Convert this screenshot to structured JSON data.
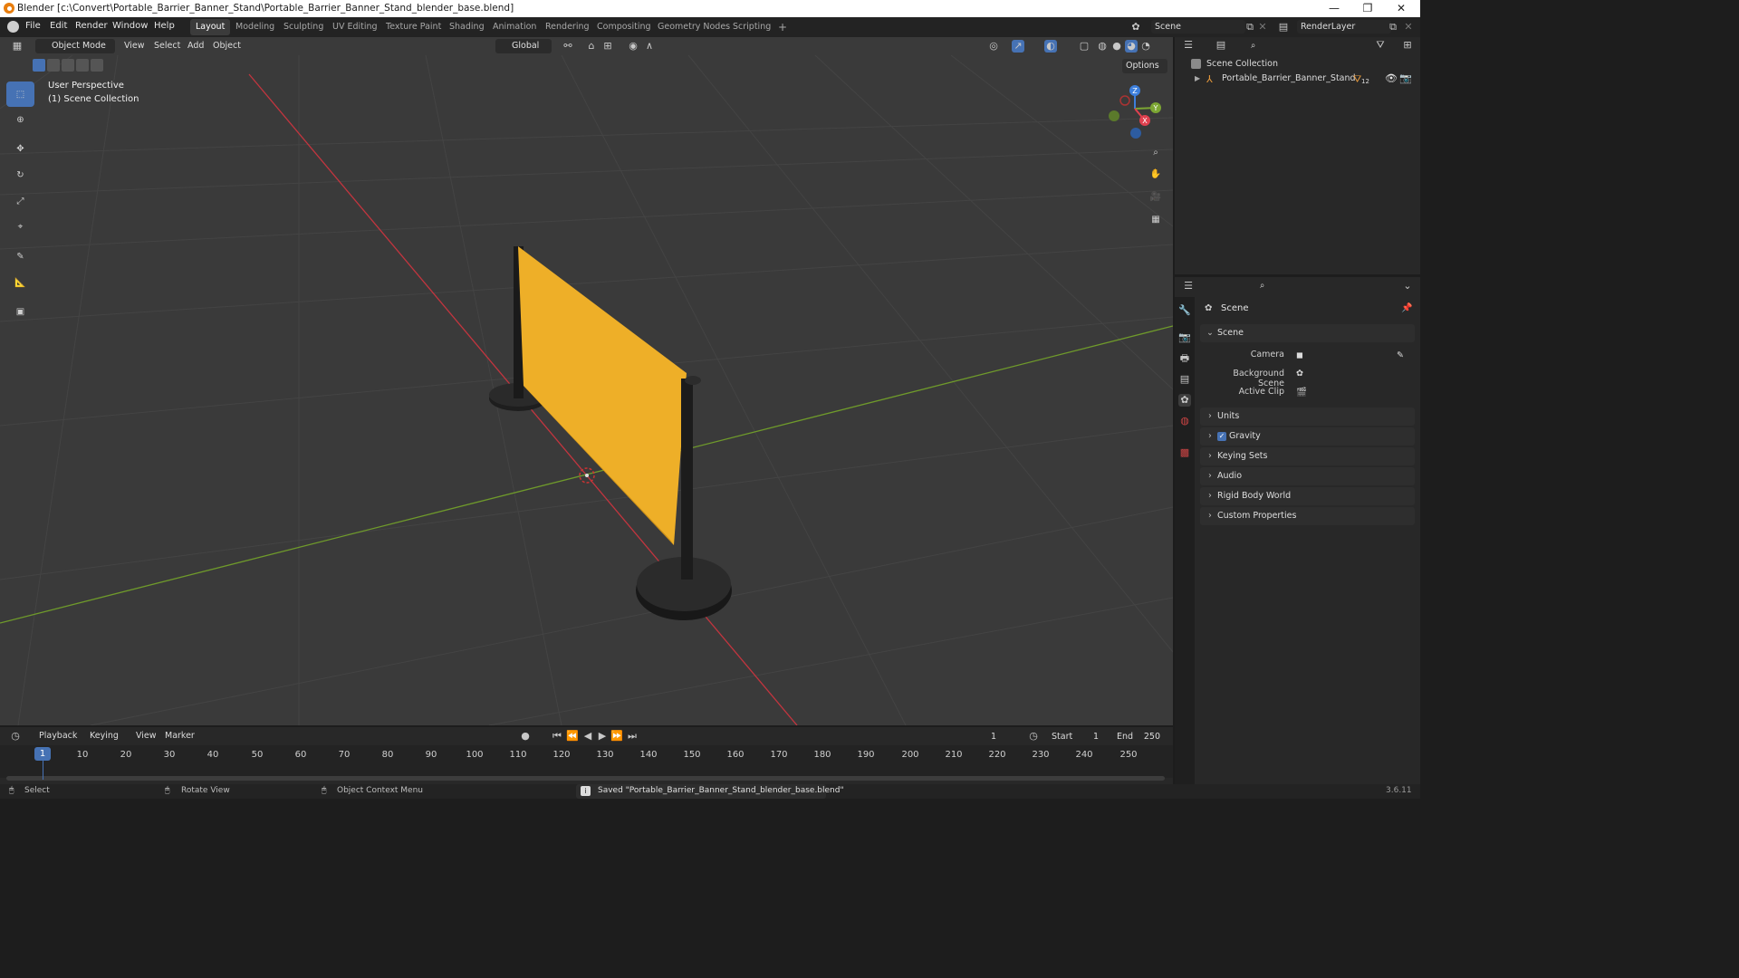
{
  "window": {
    "title": "Blender [c:\\Convert\\Portable_Barrier_Banner_Stand\\Portable_Barrier_Banner_Stand_blender_base.blend]",
    "controls": [
      "—",
      "❐",
      "✕"
    ]
  },
  "menu": {
    "items": [
      "File",
      "Edit",
      "Render",
      "Window",
      "Help"
    ],
    "workspaces": [
      "Layout",
      "Modeling",
      "Sculpting",
      "UV Editing",
      "Texture Paint",
      "Shading",
      "Animation",
      "Rendering",
      "Compositing",
      "Geometry Nodes",
      "Scripting"
    ],
    "add_tab": "+",
    "scene": "Scene",
    "view_layer": "RenderLayer"
  },
  "viewport": {
    "mode": "Object Mode",
    "menus": [
      "View",
      "Select",
      "Add",
      "Object"
    ],
    "orientation": "Global",
    "options_label": "Options",
    "overlay_line1": "User Perspective",
    "overlay_line2": "(1) Scene Collection",
    "axis_labels": {
      "z": "Z",
      "y": "Y",
      "x": "X"
    },
    "colors": {
      "background": "#3a3a3a",
      "x_axis": "#c3353f",
      "y_axis": "#6f9a2b",
      "banner": "#eeaf28",
      "selected_tool": "#4672b4"
    }
  },
  "outliner": {
    "root": "Scene Collection",
    "object": "Portable_Barrier_Banner_Stand",
    "child_count": "12"
  },
  "properties": {
    "header": "Scene",
    "section": "Scene",
    "fields": [
      {
        "label": "Camera",
        "value": ""
      },
      {
        "label": "Background Scene",
        "value": ""
      },
      {
        "label": "Active Clip",
        "value": ""
      }
    ],
    "panels": [
      "Units",
      "Gravity",
      "Keying Sets",
      "Audio",
      "Rigid Body World",
      "Custom Properties"
    ],
    "gravity_checked": true
  },
  "timeline": {
    "menus": [
      "Playback",
      "Keying",
      "View",
      "Marker"
    ],
    "current_frame": "1",
    "start_label": "Start",
    "start": "1",
    "end_label": "End",
    "end": "250",
    "ruler": [
      "10",
      "20",
      "30",
      "40",
      "50",
      "60",
      "70",
      "80",
      "90",
      "100",
      "110",
      "120",
      "130",
      "140",
      "150",
      "160",
      "170",
      "180",
      "190",
      "200",
      "210",
      "220",
      "230",
      "240",
      "250"
    ],
    "playhead": "1"
  },
  "status": {
    "select": "Select",
    "rotate": "Rotate View",
    "context": "Object Context Menu",
    "message": "Saved \"Portable_Barrier_Banner_Stand_blender_base.blend\"",
    "version": "3.6.11"
  }
}
